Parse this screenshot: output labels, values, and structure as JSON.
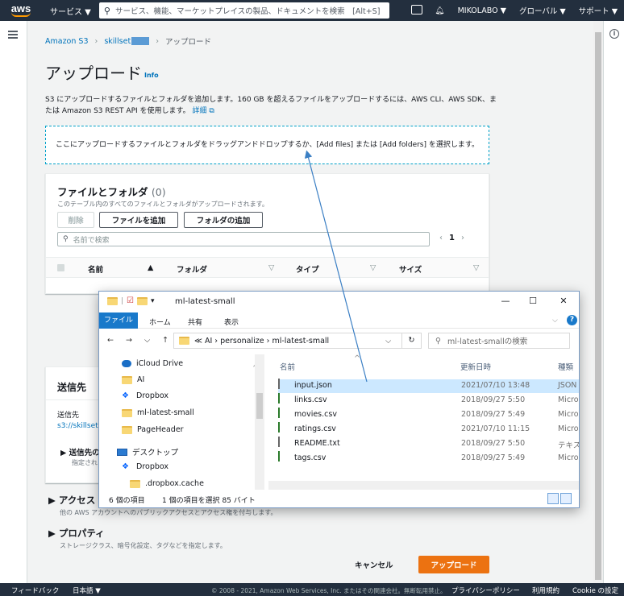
{
  "topnav": {
    "logo": "aws",
    "services": "サービス ▼",
    "search_placeholder": "サービス、機能、マーケットプレイスの製品、ドキュメントを検索　[Alt+S]",
    "account": "MIKOLABO ▼",
    "region": "グローバル ▼",
    "support": "サポート ▼"
  },
  "breadcrumb": {
    "root": "Amazon S3",
    "bucket": "skillset",
    "current": "アップロード"
  },
  "page": {
    "title": "アップロード",
    "info": "Info",
    "description": "S3 にアップロードするファイルとフォルダを追加します。160 GB を超えるファイルをアップロードするには、AWS CLI、AWS SDK、または Amazon S3 REST API を使用します。",
    "details_link": "詳細",
    "dropzone": "ここにアップロードするファイルとフォルダをドラッグアンドドロップするか、[Add files] または [Add folders] を選択します。"
  },
  "files_panel": {
    "title": "ファイルとフォルダ",
    "count": "(0)",
    "subtitle": "このテーブル内のすべてのファイルとフォルダがアップロードされます。",
    "delete": "削除",
    "add_files": "ファイルを追加",
    "add_folder": "フォルダの追加",
    "filter_placeholder": "名前で検索",
    "page": "1",
    "columns": [
      "名前",
      "フォルダ",
      "タイプ",
      "サイズ"
    ]
  },
  "destination": {
    "title": "送信先",
    "label": "送信先",
    "value": "s3://skillset",
    "details": "▶ 送信先の",
    "details_sub": "指定され"
  },
  "sections": {
    "access": "▶ アクセス",
    "access_sub": "他の AWS アカウントへのパブリックアクセスとアクセス権を付与します。",
    "props": "▶ プロパティ",
    "props_sub": "ストレージクラス、暗号化設定、タグなどを指定します。"
  },
  "actions": {
    "cancel": "キャンセル",
    "upload": "アップロード"
  },
  "footer": {
    "feedback": "フィードバック",
    "lang": "日本語 ▼",
    "copyright": "© 2008 - 2021, Amazon Web Services, Inc. またはその関連会社。無断転用禁止。",
    "privacy": "プライバシーポリシー",
    "terms": "利用規約",
    "cookie": "Cookie の設定"
  },
  "explorer": {
    "title": "ml-latest-small",
    "ribbon": [
      "ファイル",
      "ホーム",
      "共有",
      "表示"
    ],
    "path": "≪  AI  ›  personalize  ›  ml-latest-small",
    "search_placeholder": "ml-latest-smallの検索",
    "nav": [
      "iCloud Drive",
      "AI",
      "Dropbox",
      "ml-latest-small",
      "PageHeader",
      "デスクトップ",
      "Dropbox",
      ".dropbox.cache"
    ],
    "headers": [
      "名前",
      "更新日時",
      "種類"
    ],
    "files": [
      {
        "name": "input.json",
        "date": "2021/07/10 13:48",
        "type": "JSON"
      },
      {
        "name": "links.csv",
        "date": "2018/09/27 5:50",
        "type": "Micro"
      },
      {
        "name": "movies.csv",
        "date": "2018/09/27 5:49",
        "type": "Micro"
      },
      {
        "name": "ratings.csv",
        "date": "2021/07/10 11:15",
        "type": "Micro"
      },
      {
        "name": "README.txt",
        "date": "2018/09/27 5:50",
        "type": "テキス"
      },
      {
        "name": "tags.csv",
        "date": "2018/09/27 5:49",
        "type": "Micro"
      }
    ],
    "status_count": "6 個の項目",
    "status_sel": "1 個の項目を選択  85 バイト"
  }
}
